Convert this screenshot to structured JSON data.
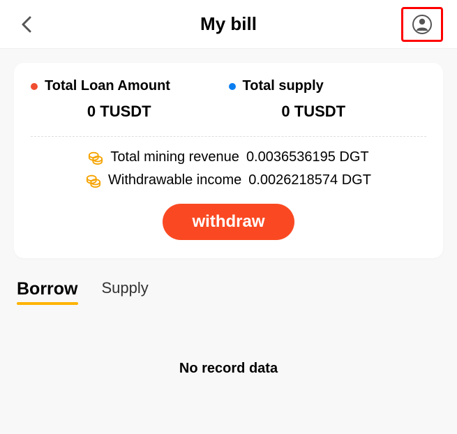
{
  "header": {
    "title": "My bill"
  },
  "card": {
    "loan": {
      "label": "Total Loan Amount",
      "value": "0 TUSDT"
    },
    "supply": {
      "label": "Total supply",
      "value": "0 TUSDT"
    },
    "mining": {
      "label": "Total mining revenue",
      "value": "0.0036536195 DGT"
    },
    "withdrawable": {
      "label": "Withdrawable income",
      "value": "0.0026218574 DGT"
    },
    "withdraw_label": "withdraw"
  },
  "tabs": {
    "borrow": "Borrow",
    "supply": "Supply"
  },
  "empty_text": "No record data"
}
